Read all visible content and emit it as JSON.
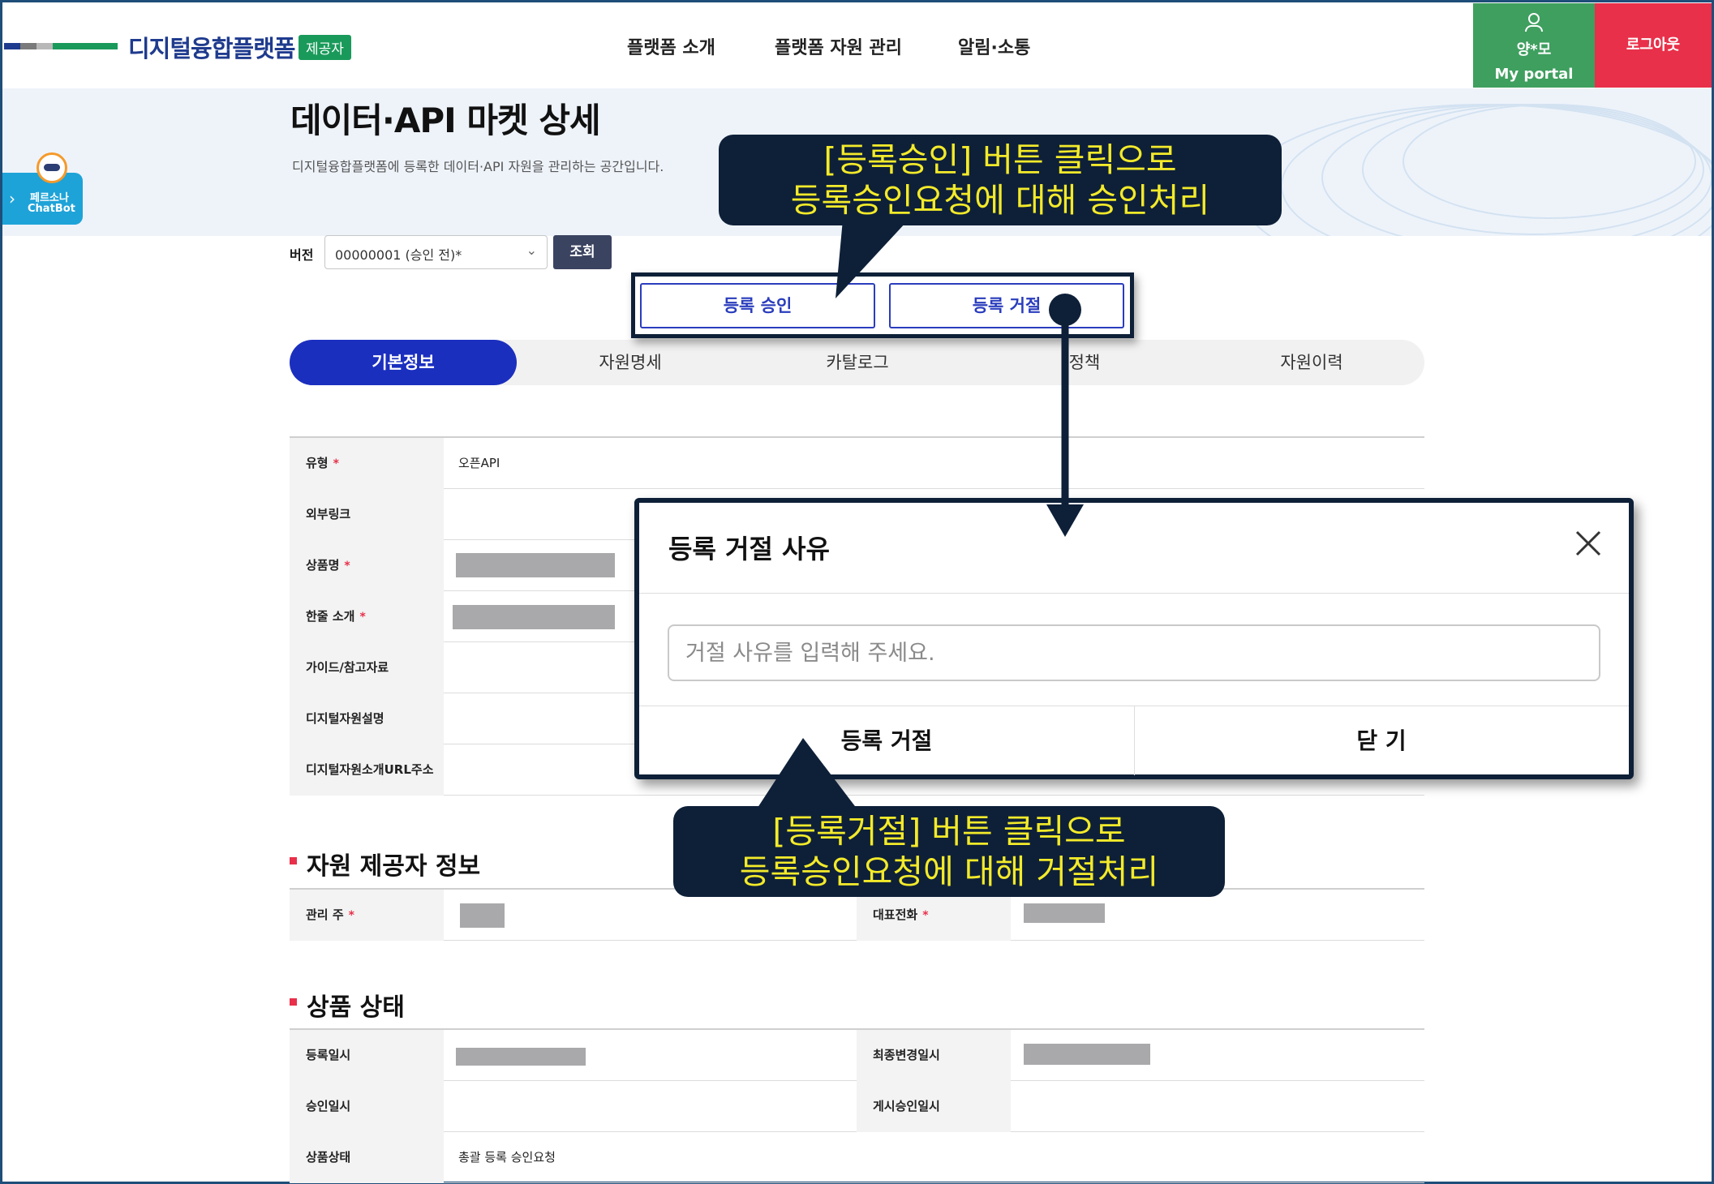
{
  "header": {
    "logo_text": "디지털융합플랫폼",
    "provider_badge": "제공자",
    "nav": [
      "플랫폼 소개",
      "플랫폼 자원 관리",
      "알림·소통"
    ],
    "user_name": "양*모",
    "portal_label": "My portal",
    "logout_label": "로그아웃",
    "colors": {
      "portal": "#3f9f5f",
      "logout": "#e8304a",
      "logo": "#1f3b8e"
    }
  },
  "hero": {
    "title": "데이터·API 마켓 상세",
    "description": "디지털융합플랫폼에 등록한 데이터·API 자원을 관리하는 공간입니다."
  },
  "chatbot": {
    "line1": "페르소나",
    "line2": "ChatBot"
  },
  "version": {
    "label": "버전",
    "selected": "00000001 (승인 전)*",
    "query_button": "조회"
  },
  "actions": {
    "approve": "등록 승인",
    "reject": "등록 거절"
  },
  "tabs": [
    "기본정보",
    "자원명세",
    "카탈로그",
    "정책",
    "자원이력"
  ],
  "basic_info": {
    "rows": [
      {
        "label": "유형",
        "required": true,
        "value": "오픈API"
      },
      {
        "label": "외부링크",
        "required": false,
        "value": ""
      },
      {
        "label": "상품명",
        "required": true,
        "value": ""
      },
      {
        "label": "한줄 소개",
        "required": true,
        "value": ""
      },
      {
        "label": "가이드/참고자료",
        "required": false,
        "value": ""
      },
      {
        "label": "디지털자원설명",
        "required": false,
        "value": ""
      },
      {
        "label": "디지털자원소개URL주소",
        "required": false,
        "value": ""
      }
    ]
  },
  "provider_section": {
    "title": "자원 제공자 정보",
    "left_label": "관리 주",
    "right_label": "대표전화"
  },
  "status_section": {
    "title": "상품 상태",
    "rows": [
      {
        "left": "등록일시",
        "right": "최종변경일시"
      },
      {
        "left": "승인일시",
        "right": "게시승인일시"
      },
      {
        "left": "상품상태",
        "left_value": "총괄 등록 승인요청"
      }
    ]
  },
  "required_mark": "*",
  "modal": {
    "title": "등록 거절 사유",
    "input_placeholder": "거절 사유를 입력해 주세요.",
    "reject_button": "등록 거절",
    "close_button": "닫 기"
  },
  "callouts": {
    "top_line1": "[등록승인] 버튼 클릭으로",
    "top_line2": "등록승인요청에 대해 승인처리",
    "bottom_line1": "[등록거절] 버튼 클릭으로",
    "bottom_line2": "등록승인요청에 대해 거절처리",
    "bg_color": "#0e2038",
    "text_color": "#f3ea2a"
  }
}
